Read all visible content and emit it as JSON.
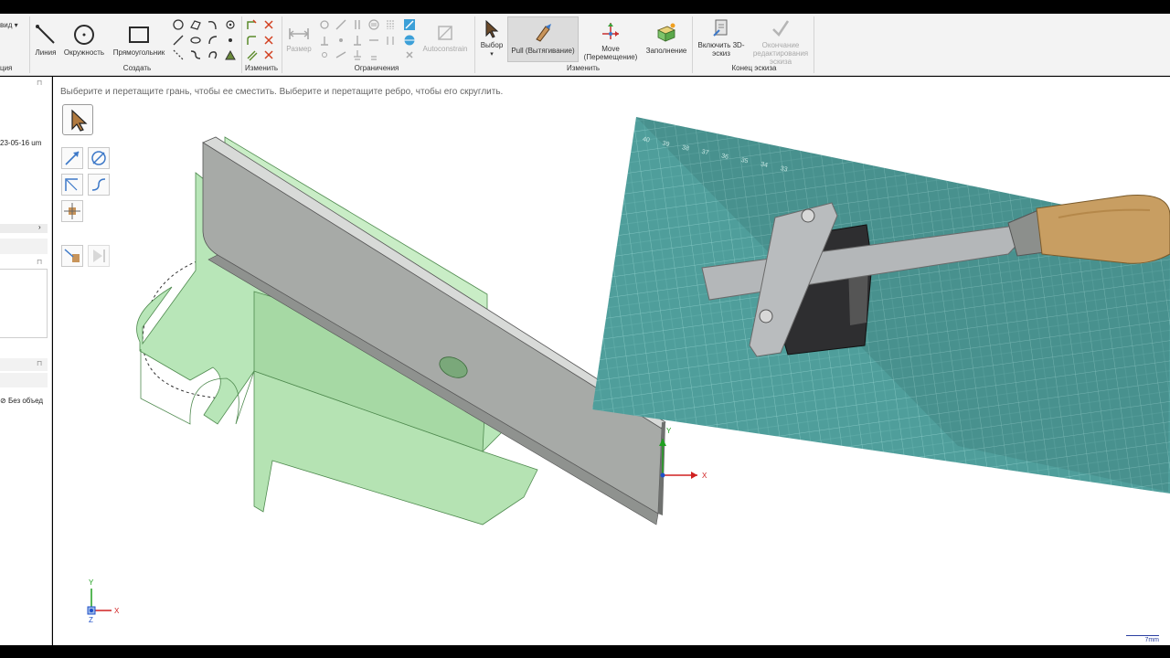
{
  "ribbon": {
    "view_label": "вид",
    "tab_fragment": "ция",
    "create": {
      "group_label": "Создать",
      "line": "Линия",
      "circle": "Окружность",
      "rectangle": "Прямоугольник"
    },
    "modify_small": {
      "group_label": "Изменить"
    },
    "constraints": {
      "group_label": "Ограничения",
      "dimension": "Размер",
      "autoconstrain": "Autoconstrain"
    },
    "edit": {
      "group_label": "Изменить",
      "select": "Выбор",
      "pull": "Pull (Вытягивание)",
      "move_line1": "Move",
      "move_line2": "(Перемещение)",
      "fill": "Заполнение"
    },
    "sketch_end": {
      "group_label": "Конец эскиза",
      "enable3d_line1": "Включить 3D-",
      "enable3d_line2": "эскиз",
      "finish_line1": "Окончание",
      "finish_line2": "редактирования",
      "finish_line3": "эскиза"
    }
  },
  "leftpanel": {
    "date_text": "23-05-16 um",
    "no_object": "Без объед"
  },
  "viewport": {
    "hint": "Выберите и перетащите грань, чтобы ее сместить. Выберите и перетащите ребро, чтобы его скруглить.",
    "axis_x": "X",
    "axis_y": "Y",
    "axis_z": "Z",
    "scale_label": "7mm"
  },
  "photo": {
    "ruler_numbers": [
      "40",
      "39",
      "38",
      "37",
      "36",
      "35",
      "34",
      "33"
    ]
  },
  "colors": {
    "accent": "#1f6fd1",
    "model_green": "#b8e6b8",
    "model_grey": "#a7aaa7",
    "mat_teal": "#4f9e9b"
  }
}
